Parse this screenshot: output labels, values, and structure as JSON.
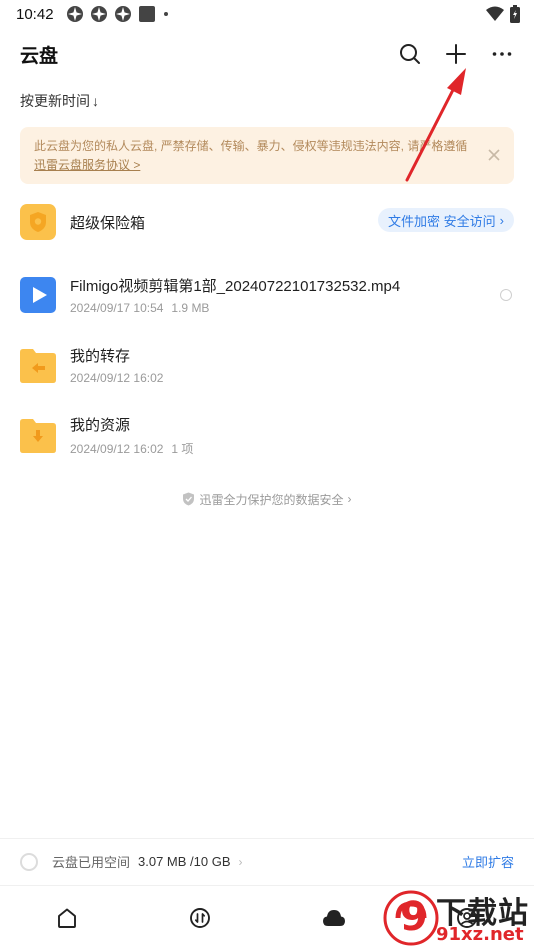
{
  "status_bar": {
    "time": "10:42"
  },
  "header": {
    "title": "云盘"
  },
  "sort": {
    "label": "按更新时间",
    "arrow": "↓"
  },
  "notice": {
    "text": "此云盘为您的私人云盘, 严禁存储、传输、暴力、侵权等违规违法内容, 请严格遵循",
    "link_text": "迅雷云盘服务协议 >"
  },
  "vault": {
    "name": "超级保险箱",
    "tag": "文件加密 安全访问",
    "tag_arrow": "›"
  },
  "files": [
    {
      "name": "Filmigo视频剪辑第1部_20240722101732532.mp4",
      "date": "2024/09/17 10:54",
      "size": "1.9 MB",
      "icon": "video-file-icon"
    },
    {
      "name": "我的转存",
      "date": "2024/09/12 16:02",
      "size": "",
      "icon": "folder-transfer-icon"
    },
    {
      "name": "我的资源",
      "date": "2024/09/12 16:02",
      "size": "1 项",
      "icon": "folder-download-icon"
    }
  ],
  "safety": {
    "text": "迅雷全力保护您的数据安全",
    "arrow": "›"
  },
  "storage": {
    "label": "云盘已用空间",
    "value": "3.07 MB /10 GB",
    "chevron": "›",
    "expand": "立即扩容"
  },
  "tabbar": {
    "tabs": [
      {
        "icon": "home-icon"
      },
      {
        "icon": "transfer-icon"
      },
      {
        "icon": "cloud-icon"
      },
      {
        "icon": "profile-icon"
      }
    ]
  },
  "watermark": {
    "text_main": "下载站",
    "text_url": "91xz.net",
    "logo_number": "9"
  },
  "colors": {
    "accent": "#2f7be5",
    "notice_bg": "#fdf1e2",
    "folder": "#fbc14b",
    "arrow_red": "#e0262a"
  }
}
